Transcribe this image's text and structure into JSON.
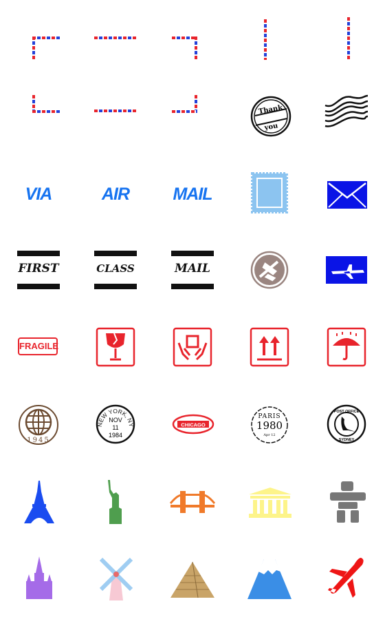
{
  "stickers": {
    "via": "VIA",
    "air": "AIR",
    "mail_blue": "MAIL",
    "first": "FIRST",
    "class": "CLASS",
    "mail_black": "MAIL",
    "thank": "Thank",
    "you": "you",
    "fragile": "FRAGILE",
    "globe_year": "1945",
    "ny_city": "NEW YORK, NY",
    "ny_month": "NOV",
    "ny_day": "11",
    "ny_year": "1984",
    "chicago": "CHICAGO",
    "paris_city": "PARIS",
    "paris_year": "1980",
    "paris_date": "Apr 12",
    "po_top": "POST OFFICE",
    "po_bottom": "SYDNEY"
  },
  "colors": {
    "red": "#e8242c",
    "blue": "#2340d8",
    "airBlue": "#1673f0",
    "stampBlue": "#8cc4f0",
    "envelopeBlue": "#0a14e6"
  },
  "icons": [
    "airmail-border-top-left",
    "airmail-border-top",
    "airmail-border-top-right",
    "airmail-border-vertical",
    "airmail-border-vertical",
    "airmail-border-bottom-left",
    "airmail-border-bottom",
    "airmail-border-bottom-right",
    "thank-you-stamp",
    "postmark-waves",
    "stamp",
    "envelope",
    "airplane-circle",
    "airplane-card",
    "broken-glass",
    "handle-with-care",
    "this-way-up",
    "keep-dry-umbrella",
    "globe-stamp",
    "new-york-postmark",
    "chicago-stamp",
    "paris-stamp",
    "sydney-kangaroo-stamp",
    "eiffel-tower",
    "statue-of-liberty",
    "tower-bridge",
    "parthenon",
    "inukshuk",
    "st-basils-cathedral",
    "windmill",
    "pyramid",
    "mount-fuji",
    "airplane"
  ]
}
